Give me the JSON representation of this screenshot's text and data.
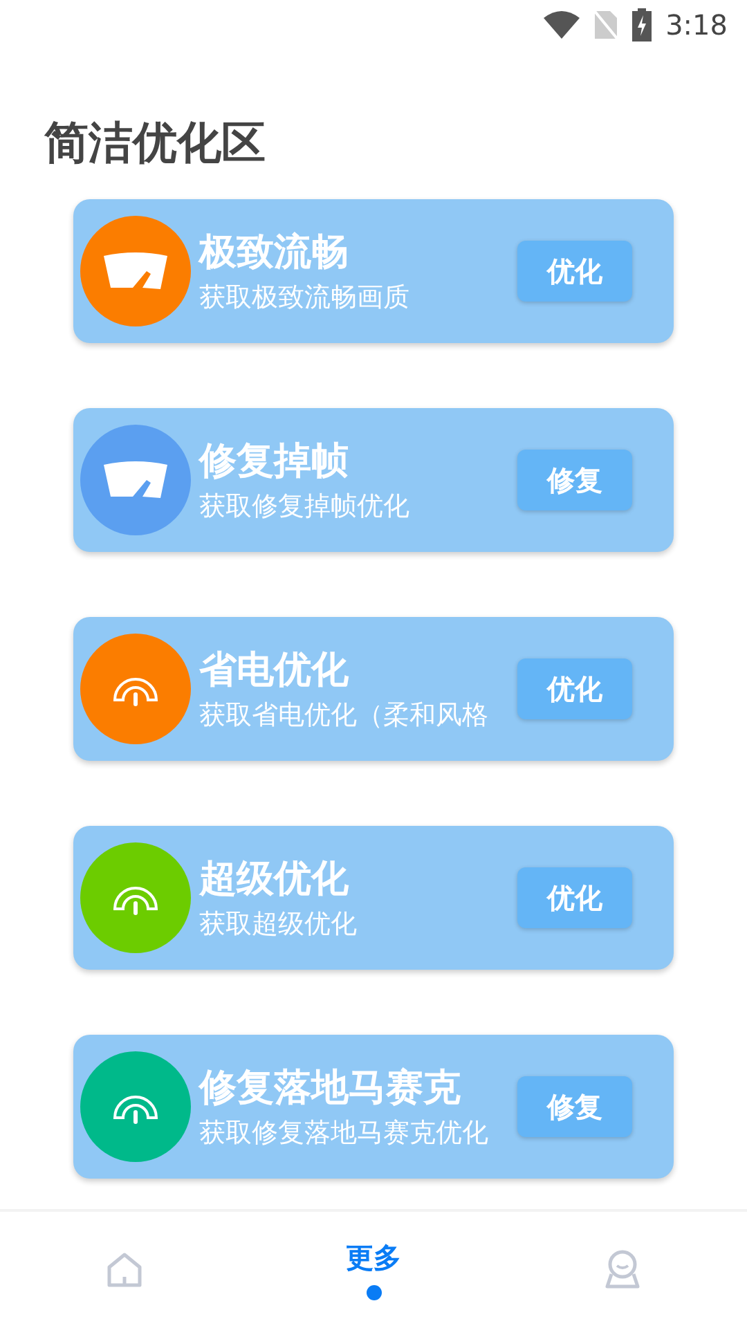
{
  "status_bar": {
    "time": "3:18"
  },
  "title": "简洁优化区",
  "cards": [
    {
      "kind": "wiper",
      "color": "#fb7d00",
      "title": "极致流畅",
      "subtitle": "获取极致流畅画质",
      "button": "优化"
    },
    {
      "kind": "wiper",
      "color": "#5b9ff0",
      "title": "修复掉帧",
      "subtitle": "获取修复掉帧优化",
      "button": "修复"
    },
    {
      "kind": "gauge",
      "color": "#fb7d00",
      "title": "省电优化",
      "subtitle": "获取省电优化（柔和风格",
      "button": "优化"
    },
    {
      "kind": "gauge",
      "color": "#6ccc00",
      "title": "超级优化",
      "subtitle": "获取超级优化",
      "button": "优化"
    },
    {
      "kind": "gauge",
      "color": "#00b98a",
      "title": "修复落地马赛克",
      "subtitle": "获取修复落地马赛克优化",
      "button": "修复"
    }
  ],
  "tabs": [
    {
      "kind": "home",
      "selected": false
    },
    {
      "kind": "text",
      "label": "更多",
      "selected": true
    },
    {
      "kind": "profile",
      "selected": false
    }
  ]
}
